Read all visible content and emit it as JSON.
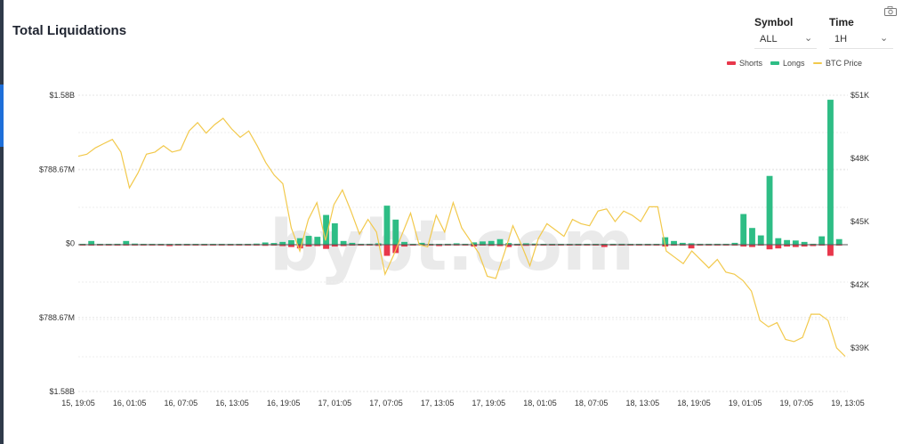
{
  "title": "Total Liquidations",
  "controls": {
    "symbol_label": "Symbol",
    "symbol_value": "ALL",
    "time_label": "Time",
    "time_value": "1H"
  },
  "icons": {
    "camera": "camera-icon",
    "dropdown": "chevron-down-icon"
  },
  "watermark": "bybt.com",
  "colors": {
    "shorts": "#e8374b",
    "longs": "#2ebd85",
    "btc_price": "#f2c94c"
  },
  "chart_data": {
    "type": "bar",
    "legend": [
      "Shorts",
      "Longs",
      "BTC Price"
    ],
    "legend_position": "top-right",
    "grid": true,
    "x_tick_labels": [
      "15, 19:05",
      "16, 01:05",
      "16, 07:05",
      "16, 13:05",
      "16, 19:05",
      "17, 01:05",
      "17, 07:05",
      "17, 13:05",
      "17, 19:05",
      "18, 01:05",
      "18, 07:05",
      "18, 13:05",
      "18, 19:05",
      "19, 01:05",
      "19, 07:05",
      "19, 13:05"
    ],
    "y_left_tick_labels": [
      "$1.58B",
      "$788.67M",
      "$0",
      "$788.67M",
      "$1.58B"
    ],
    "y_left_range": [
      -1580,
      1580
    ],
    "y_left_unit": "M USD (longs positive, shorts negative)",
    "y_right_tick_labels": [
      "$51K",
      "$48K",
      "$45K",
      "$42K",
      "$39K"
    ],
    "y_right_range": [
      37900,
      51000
    ],
    "hours_per_point": 2,
    "longs": [
      6,
      40,
      4,
      2,
      10,
      40,
      12,
      3,
      4,
      2,
      3,
      4,
      2,
      3,
      3,
      2,
      3,
      3,
      4,
      4,
      12,
      24,
      18,
      30,
      48,
      70,
      95,
      85,
      320,
      230,
      40,
      20,
      10,
      10,
      15,
      420,
      270,
      30,
      10,
      20,
      3,
      5,
      10,
      15,
      10,
      25,
      35,
      40,
      60,
      18,
      10,
      15,
      12,
      8,
      8,
      5,
      3,
      4,
      3,
      3,
      10,
      10,
      10,
      8,
      8,
      6,
      3,
      80,
      40,
      20,
      15,
      10,
      10,
      10,
      10,
      20,
      330,
      180,
      100,
      740,
      70,
      50,
      45,
      30,
      10,
      90,
      1560,
      60
    ],
    "shorts": [
      3,
      2,
      3,
      2,
      10,
      5,
      8,
      6,
      3,
      5,
      15,
      3,
      10,
      5,
      3,
      4,
      3,
      3,
      6,
      3,
      10,
      12,
      6,
      15,
      25,
      40,
      20,
      15,
      45,
      20,
      15,
      10,
      8,
      8,
      12,
      120,
      90,
      20,
      10,
      8,
      10,
      15,
      8,
      6,
      8,
      20,
      8,
      12,
      15,
      25,
      10,
      12,
      4,
      5,
      4,
      3,
      4,
      3,
      5,
      4,
      25,
      5,
      6,
      5,
      5,
      5,
      4,
      20,
      10,
      8,
      40,
      10,
      8,
      8,
      8,
      5,
      20,
      25,
      10,
      50,
      40,
      20,
      25,
      20,
      15,
      10,
      120,
      10
    ],
    "btc_price": [
      48100,
      48200,
      48500,
      48700,
      48900,
      48300,
      46600,
      47300,
      48200,
      48300,
      48600,
      48300,
      48400,
      49300,
      49700,
      49200,
      49600,
      49900,
      49400,
      49000,
      49300,
      48600,
      47800,
      47200,
      46800,
      44700,
      43600,
      45100,
      45900,
      44100,
      45800,
      46500,
      45500,
      44400,
      45100,
      44500,
      42500,
      43400,
      44400,
      45400,
      43900,
      43800,
      45300,
      44500,
      45900,
      44700,
      44100,
      43500,
      42400,
      42300,
      43500,
      44800,
      43900,
      42900,
      44200,
      44900,
      44600,
      44300,
      45100,
      44900,
      44800,
      45500,
      45600,
      45000,
      45500,
      45300,
      45000,
      45700,
      45700,
      43600,
      43300,
      43000,
      43600,
      43200,
      42800,
      43200,
      42600,
      42500,
      42200,
      41700,
      40300,
      40000,
      40200,
      39400,
      39300,
      39500,
      40600,
      40600,
      40300,
      39000,
      38600
    ]
  }
}
